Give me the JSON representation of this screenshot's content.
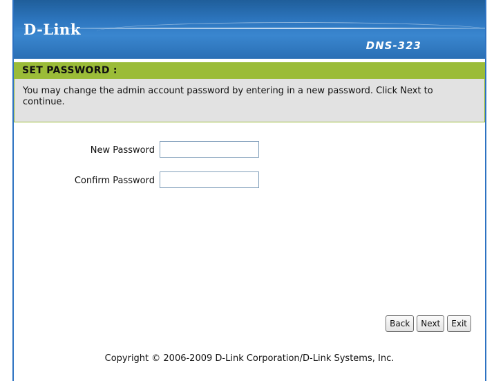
{
  "header": {
    "logo_text": "D-Link",
    "model": "DNS-323"
  },
  "section": {
    "title": "SET PASSWORD :",
    "description": "You may change the admin account password by entering in a new password. Click Next to continue."
  },
  "form": {
    "new_password_label": "New Password",
    "new_password_value": "",
    "confirm_password_label": "Confirm Password",
    "confirm_password_value": ""
  },
  "buttons": {
    "back": "Back",
    "next": "Next",
    "exit": "Exit"
  },
  "footer": {
    "copyright": "Copyright © 2006-2009 D-Link Corporation/D-Link Systems, Inc."
  },
  "colors": {
    "banner": "#2d76bf",
    "section_head": "#9bbc38",
    "description_bg": "#e2e2e2",
    "frame_border": "#2d72c2"
  }
}
